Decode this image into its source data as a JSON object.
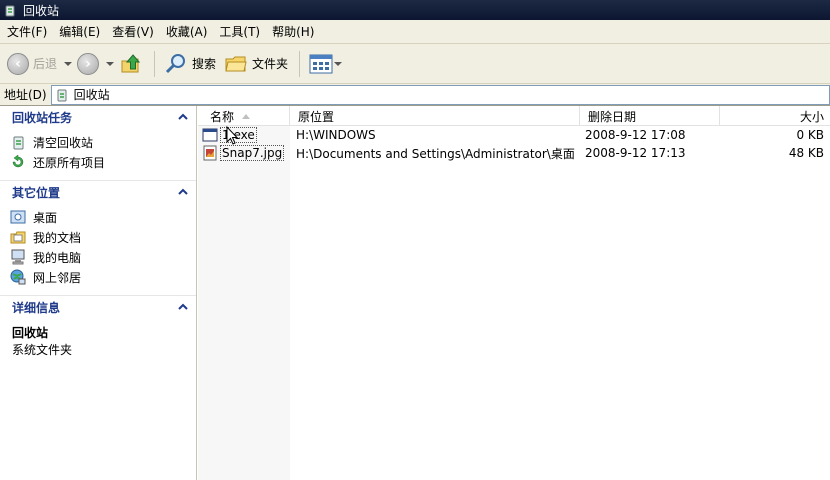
{
  "window": {
    "title": "回收站",
    "icon": "recycle-bin-icon"
  },
  "menu": [
    "文件(F)",
    "编辑(E)",
    "查看(V)",
    "收藏(A)",
    "工具(T)",
    "帮助(H)"
  ],
  "toolbar": {
    "back_label": "后退",
    "search_label": "搜索",
    "folders_label": "文件夹"
  },
  "address": {
    "label": "地址(D)",
    "value": "回收站"
  },
  "tasks": {
    "header": "回收站任务",
    "items": [
      "清空回收站",
      "还原所有项目"
    ]
  },
  "places": {
    "header": "其它位置",
    "items": [
      "桌面",
      "我的文档",
      "我的电脑",
      "网上邻居"
    ]
  },
  "details": {
    "header": "详细信息",
    "name": "回收站",
    "type": "系统文件夹"
  },
  "columns": {
    "name": "名称",
    "location": "原位置",
    "date": "删除日期",
    "size": "大小"
  },
  "files": [
    {
      "name": "1.exe",
      "location": "H:\\WINDOWS",
      "date": "2008-9-12 17:08",
      "size": "0 KB",
      "icon": "exe-icon"
    },
    {
      "name": "Snap7.jpg",
      "location": "H:\\Documents and Settings\\Administrator\\桌面",
      "date": "2008-9-12 17:13",
      "size": "48 KB",
      "icon": "jpg-icon"
    }
  ],
  "colors": {
    "title_bar": "#0c1630",
    "task_header": "#1f3a8a",
    "chrome": "#f1efe2"
  }
}
